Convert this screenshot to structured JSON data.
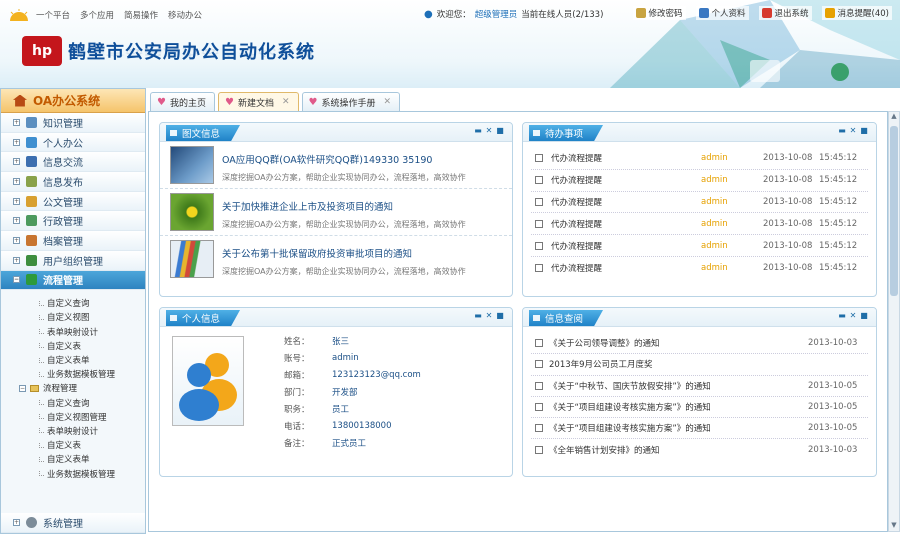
{
  "header": {
    "slogan": [
      "一个平台",
      "多个应用",
      "简易操作",
      "移动办公"
    ],
    "title": "鹤壁市公安局办公自动化系统",
    "logo_text": "hp",
    "welcome_prefix": "欢迎您：",
    "user_name": "超级管理员",
    "online_text": "当前在线人员(2/133)",
    "toolbar": [
      {
        "label": "修改密码",
        "icon": "key-icon",
        "color": "#c9a441"
      },
      {
        "label": "个人资料",
        "icon": "person-icon",
        "color": "#3a78c2"
      },
      {
        "label": "退出系统",
        "icon": "exit-icon",
        "color": "#d63a2f"
      },
      {
        "label": "消息提醒(40)",
        "icon": "message-icon",
        "color": "#e6a100"
      }
    ]
  },
  "sidebar": {
    "title": "OA办公系统",
    "items": [
      {
        "label": "知识管理",
        "color": "#5c8fc0"
      },
      {
        "label": "个人办公",
        "color": "#3f8fd0"
      },
      {
        "label": "信息交流",
        "color": "#3d6fb0"
      },
      {
        "label": "信息发布",
        "color": "#8aa24a"
      },
      {
        "label": "公文管理",
        "color": "#d8a030"
      },
      {
        "label": "行政管理",
        "color": "#4d9a5e"
      },
      {
        "label": "档案管理",
        "color": "#c87530"
      },
      {
        "label": "用户组织管理",
        "color": "#3e8e3e"
      },
      {
        "label": "流程管理",
        "color": "#2d9a3a"
      }
    ],
    "subs_a": [
      "自定义查询",
      "自定义视图",
      "表单映射设计",
      "自定义表",
      "自定义表单",
      "业务数据模板管理"
    ],
    "group_label": "流程管理",
    "subs_b": [
      "自定义查询",
      "自定义视图管理",
      "表单映射设计",
      "自定义表",
      "自定义表单",
      "业务数据模板管理"
    ],
    "bottom_item": "系统管理"
  },
  "tabs": [
    {
      "label": "我的主页",
      "closable": false,
      "active": false
    },
    {
      "label": "新建文档",
      "closable": true,
      "active": true
    },
    {
      "label": "系统操作手册",
      "closable": true,
      "active": false
    }
  ],
  "panels": {
    "news": {
      "title": "图文信息",
      "items": [
        {
          "title": "OA应用QQ群(OA软件研究QQ群)149330 35190",
          "desc": "深度挖掘OA办公方案，帮助企业实现协同办公，流程落地，高效协作"
        },
        {
          "title": "关于加快推进企业上市及投资项目的通知",
          "desc": "深度挖掘OA办公方案，帮助企业实现协同办公，流程落地，高效协作"
        },
        {
          "title": "关于公布第十批保留政府投资审批项目的通知",
          "desc": "深度挖掘OA办公方案，帮助企业实现协同办公，流程落地，高效协作"
        }
      ]
    },
    "todo": {
      "title": "待办事项",
      "items": [
        {
          "title": "代办流程提醒",
          "author": "admin",
          "date": "2013-10-08",
          "time": "15:45:12"
        },
        {
          "title": "代办流程提醒",
          "author": "admin",
          "date": "2013-10-08",
          "time": "15:45:12"
        },
        {
          "title": "代办流程提醒",
          "author": "admin",
          "date": "2013-10-08",
          "time": "15:45:12"
        },
        {
          "title": "代办流程提醒",
          "author": "admin",
          "date": "2013-10-08",
          "time": "15:45:12"
        },
        {
          "title": "代办流程提醒",
          "author": "admin",
          "date": "2013-10-08",
          "time": "15:45:12"
        },
        {
          "title": "代办流程提醒",
          "author": "admin",
          "date": "2013-10-08",
          "time": "15:45:12"
        }
      ]
    },
    "personal": {
      "title": "个人信息",
      "fields": [
        {
          "label": "姓名：",
          "value": "张三"
        },
        {
          "label": "账号：",
          "value": "admin"
        },
        {
          "label": "邮箱：",
          "value": "123123123@qq.com"
        },
        {
          "label": "部门：",
          "value": "开发部"
        },
        {
          "label": "职务：",
          "value": "员工"
        },
        {
          "label": "电话：",
          "value": "13800138000"
        },
        {
          "label": "备注：",
          "value": "正式员工"
        }
      ]
    },
    "announcements": {
      "title": "信息查阅",
      "items": [
        {
          "title": "《关于公司领导调整》的通知",
          "date": "2013-10-03"
        },
        {
          "title": "2013年9月公司员工月度奖",
          "date": ""
        },
        {
          "title": "《关于“中秋节、国庆节放假安排”》的通知",
          "date": "2013-10-05"
        },
        {
          "title": "《关于“项目组建设考核实施方案”》的通知",
          "date": "2013-10-05"
        },
        {
          "title": "《关于“项目组建设考核实施方案”》的通知",
          "date": "2013-10-05"
        },
        {
          "title": "《全年销售计划安排》的通知",
          "date": "2013-10-03"
        }
      ]
    }
  }
}
